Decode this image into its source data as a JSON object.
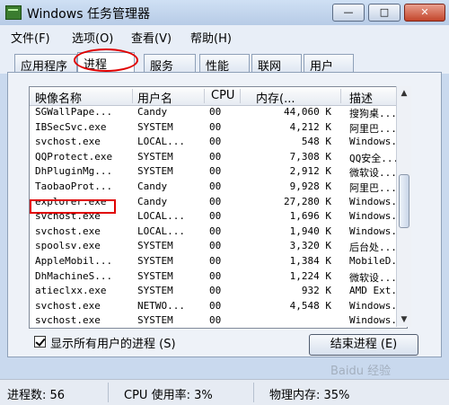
{
  "window": {
    "title": "Windows 任务管理器",
    "buttons": {
      "minimize": "—",
      "maximize": "□",
      "close": "✕"
    }
  },
  "menu": [
    "文件(F)",
    "选项(O)",
    "查看(V)",
    "帮助(H)"
  ],
  "tabs": [
    "应用程序",
    "进程",
    "服务",
    "性能",
    "联网",
    "用户"
  ],
  "active_tab": "进程",
  "table": {
    "headers": [
      "映像名称",
      "用户名",
      "CPU",
      "内存(...",
      "描述"
    ],
    "rows": [
      [
        "SGWallPape...",
        "Candy",
        "00",
        "44,060 K",
        "搜狗桌..."
      ],
      [
        "IBSecSvc.exe",
        "SYSTEM",
        "00",
        "4,212 K",
        "阿里巴..."
      ],
      [
        "svchost.exe",
        "LOCAL...",
        "00",
        "548 K",
        "Windows..."
      ],
      [
        "QQProtect.exe",
        "SYSTEM",
        "00",
        "7,308 K",
        "QQ安全..."
      ],
      [
        "DhPluginMg...",
        "SYSTEM",
        "00",
        "2,912 K",
        "微软设..."
      ],
      [
        "TaobaoProt...",
        "Candy",
        "00",
        "9,928 K",
        "阿里巴..."
      ],
      [
        "explorer.exe",
        "Candy",
        "00",
        "27,280 K",
        "Windows..."
      ],
      [
        "svchost.exe",
        "LOCAL...",
        "00",
        "1,696 K",
        "Windows..."
      ],
      [
        "svchost.exe",
        "LOCAL...",
        "00",
        "1,940 K",
        "Windows..."
      ],
      [
        "spoolsv.exe",
        "SYSTEM",
        "00",
        "3,320 K",
        "后台处..."
      ],
      [
        "AppleMobil...",
        "SYSTEM",
        "00",
        "1,384 K",
        "MobileD..."
      ],
      [
        "DhMachineS...",
        "SYSTEM",
        "00",
        "1,224 K",
        "微软设..."
      ],
      [
        "atieclxx.exe",
        "SYSTEM",
        "00",
        "932 K",
        "AMD Ext..."
      ],
      [
        "svchost.exe",
        "NETWO...",
        "00",
        "4,548 K",
        "Windows..."
      ],
      [
        "svchost.exe",
        "SYSTEM",
        "00",
        "",
        "Windows..."
      ]
    ]
  },
  "show_all_users": {
    "label": "显示所有用户的进程 (S)",
    "checked": true
  },
  "end_process_button": "结束进程 (E)",
  "status": {
    "processes": "进程数: 56",
    "cpu": "CPU 使用率: 3%",
    "memory": "物理内存: 35%"
  },
  "watermark": "Baidu 经验"
}
